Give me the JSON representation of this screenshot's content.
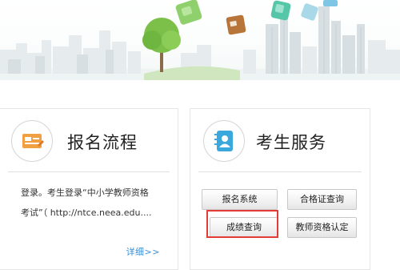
{
  "banner": {
    "decor": [
      "city-skyline",
      "tree",
      "floating-cubes"
    ],
    "colors": {
      "building": "#dfe7ea",
      "tree": "#7cc04a",
      "cube_green": "#8fd06c",
      "cube_brown": "#b8753a",
      "cube_teal": "#55c6a8"
    }
  },
  "process_card": {
    "title": "报名流程",
    "icon": "registration-card-icon",
    "icon_color": "#f0a040",
    "desc_line1": "登录。考生登录“中小学教师资格",
    "desc_line2": "考试”（ http://ntce.neea.edu....",
    "more_label": "详细>>"
  },
  "service_card": {
    "title": "考生服务",
    "icon": "candidate-notebook-icon",
    "icon_color": "#3aa7dd",
    "buttons": {
      "registration_system": "报名系统",
      "certificate_query": "合格证查询",
      "score_query": "成绩查询",
      "teacher_qualification": "教师资格认定"
    },
    "highlight_color": "#e33b36"
  }
}
